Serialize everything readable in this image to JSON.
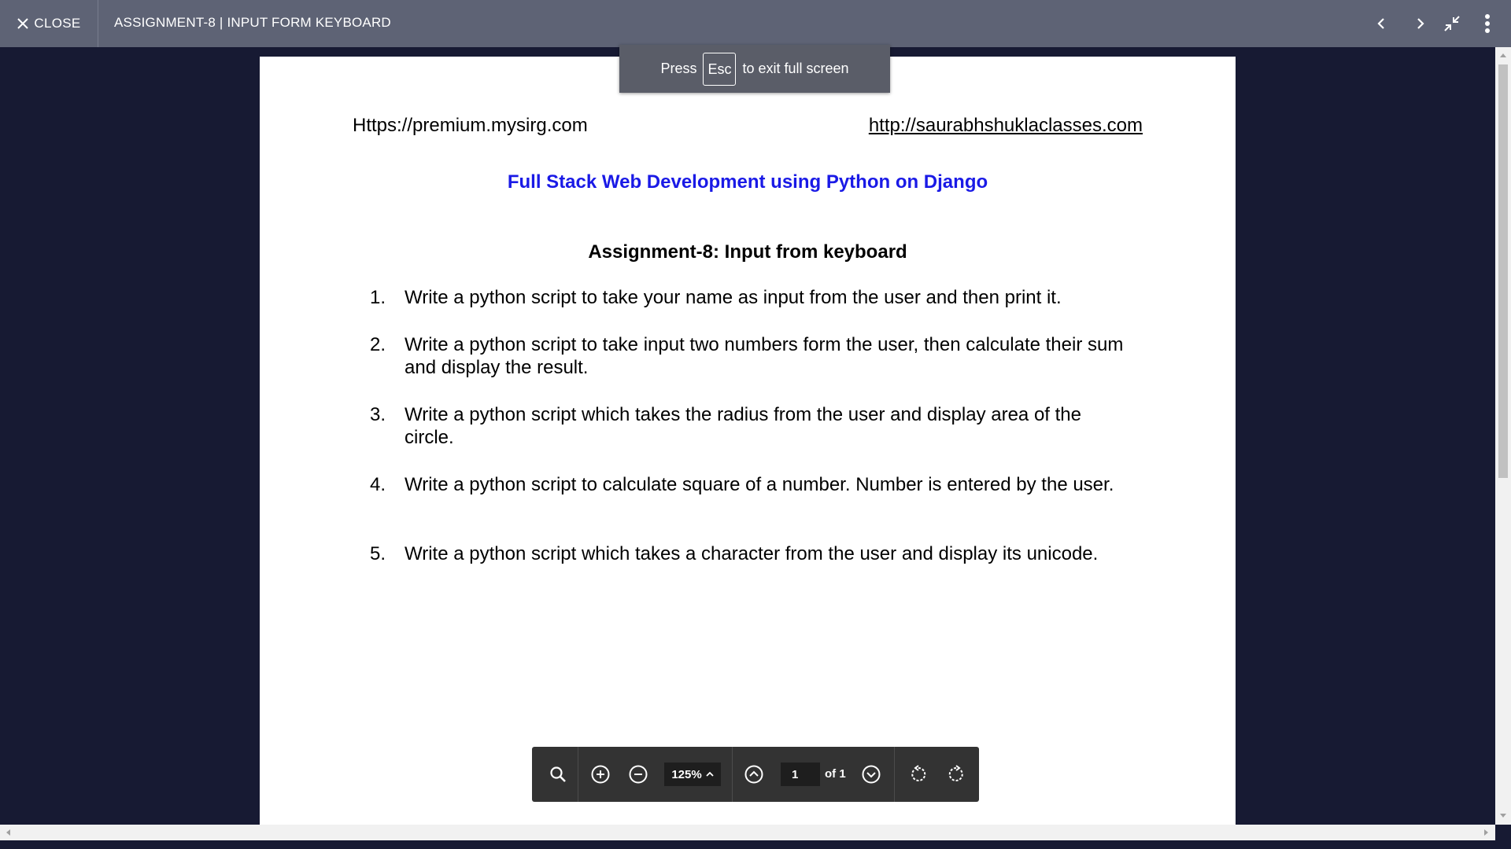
{
  "topbar": {
    "close_label": "CLOSE",
    "title": "ASSIGNMENT-8 | INPUT FORM KEYBOARD"
  },
  "toast": {
    "press": "Press",
    "key": "Esc",
    "suffix": "to exit full screen"
  },
  "document": {
    "header_left": "Https://premium.mysirg.com",
    "header_right": "http://saurabhshuklaclasses.com",
    "course_title": "Full Stack Web Development using Python on Django",
    "assignment_title": "Assignment-8: Input from keyboard",
    "questions": [
      {
        "num": "1.",
        "text": "Write a python script to take your name as input from the user and then print it."
      },
      {
        "num": "2.",
        "text": "Write a python script to take input two numbers form the user, then calculate their sum and display the result."
      },
      {
        "num": "3.",
        "text": "Write a python script which takes the radius from the user and display area of the circle."
      },
      {
        "num": "4.",
        "text": "Write a python script to calculate square of a number. Number is entered by the user."
      },
      {
        "num": "5.",
        "text": "Write a python script which takes a character from the user and display its unicode."
      }
    ]
  },
  "pdf_toolbar": {
    "zoom": "125%",
    "page_value": "1",
    "page_of": "of 1"
  },
  "colors": {
    "topbar_bg": "#5e6375",
    "viewer_bg": "#171a33",
    "course_title": "#1a1ae6",
    "toolbar_bg": "#333333"
  }
}
